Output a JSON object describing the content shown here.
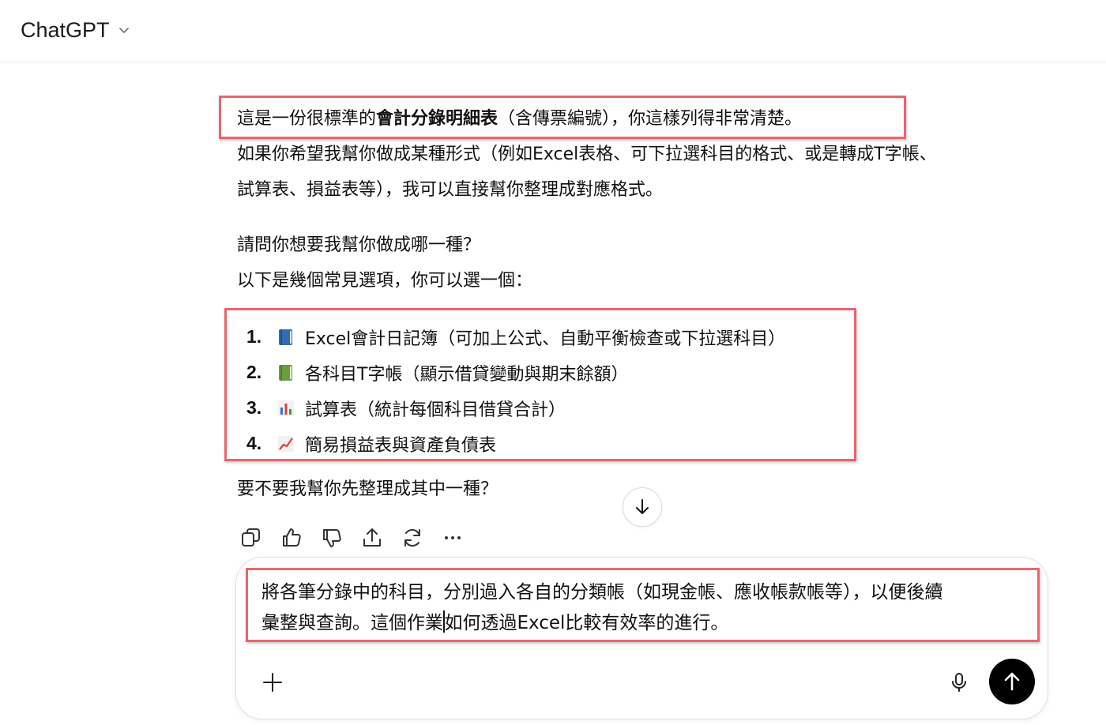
{
  "header": {
    "model_name": "ChatGPT"
  },
  "assistant_message": {
    "line1": {
      "before": "這是一份很標準的",
      "bold": "會計分錄明細表",
      "after": "（含傳票編號），你這樣列得非常清楚。"
    },
    "line2": "如果你希望我幫你做成某種形式（例如Excel表格、可下拉選科目的格式、或是轉成T字帳、",
    "line3": "試算表、損益表等），我可以直接幫你整理成對應格式。",
    "question": "請問你想要我幫你做成哪一種？",
    "options_intro": "以下是幾個常見選項，你可以選一個：",
    "options": [
      {
        "num": "1.",
        "icon": "blue-book-icon",
        "label": "Excel會計日記簿（可加上公式、自動平衡檢查或下拉選科目）"
      },
      {
        "num": "2.",
        "icon": "green-book-icon",
        "label": "各科目T字帳（顯示借貸變動與期末餘額）"
      },
      {
        "num": "3.",
        "icon": "bar-chart-icon",
        "label": "試算表（統計每個科目借貸合計）"
      },
      {
        "num": "4.",
        "icon": "trend-chart-icon",
        "label": "簡易損益表與資產負債表"
      }
    ],
    "closing": "要不要我幫你先整理成其中一種？"
  },
  "message_actions": [
    "copy-icon",
    "thumbs-up-icon",
    "thumbs-down-icon",
    "share-icon",
    "regenerate-icon",
    "more-icon"
  ],
  "composer": {
    "line1": "將各筆分錄中的科目，分別過入各自的分類帳（如現金帳、應收帳款帳等），以便後續",
    "line2_before_caret": "彙整與查詢。這個作業",
    "line2_after_caret": "如何透過Excel比較有效率的進行。"
  },
  "colors": {
    "highlight_box": "#e8666c",
    "send_button": "#000000"
  }
}
